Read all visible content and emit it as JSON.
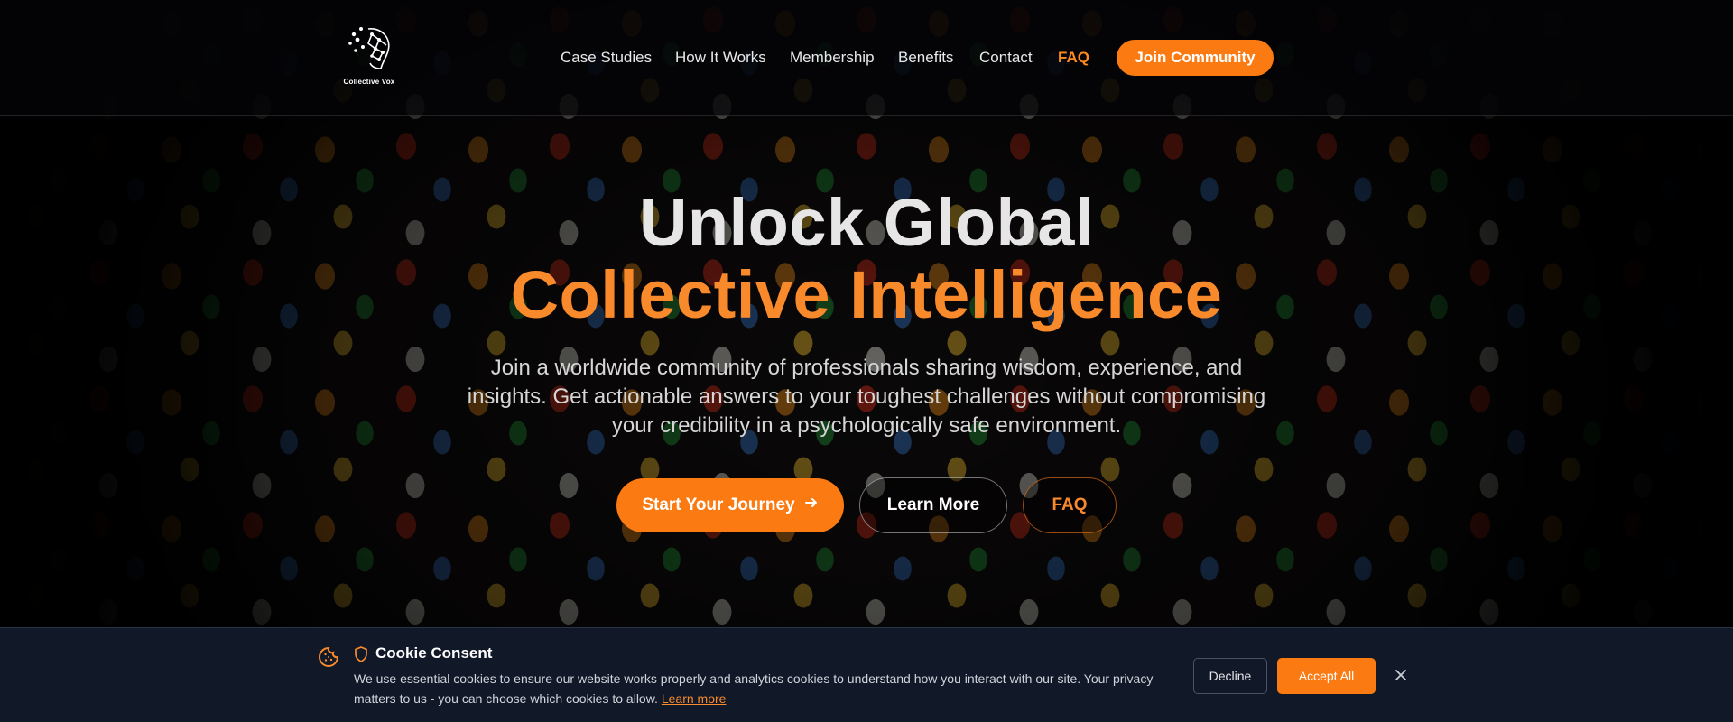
{
  "brand": {
    "name": "Collective Vox",
    "accent_color": "#fb7a12"
  },
  "nav": {
    "items": [
      {
        "label": "Case Studies"
      },
      {
        "label": "How It Works"
      },
      {
        "label": "Membership"
      },
      {
        "label": "Benefits"
      },
      {
        "label": "Contact"
      },
      {
        "label": "FAQ",
        "active": true
      }
    ],
    "cta_label": "Join Community"
  },
  "hero": {
    "title_line1": "Unlock Global",
    "title_line2": "Collective Intelligence",
    "subtitle": "Join a worldwide community of professionals sharing wisdom, experience, and insights. Get actionable answers to your toughest challenges without compromising your credibility in a psychologically safe environment.",
    "primary_button": "Start Your Journey",
    "secondary_button": "Learn More",
    "faq_button": "FAQ"
  },
  "cookie_banner": {
    "title": "Cookie Consent",
    "text": "We use essential cookies to ensure our website works properly and analytics cookies to understand how you interact with our site. Your privacy matters to us - you can choose which cookies to allow.",
    "link_text": "Learn more",
    "decline_label": "Decline",
    "accept_label": "Accept All",
    "icons": [
      "cookie-icon",
      "shield-icon",
      "close-icon"
    ]
  }
}
